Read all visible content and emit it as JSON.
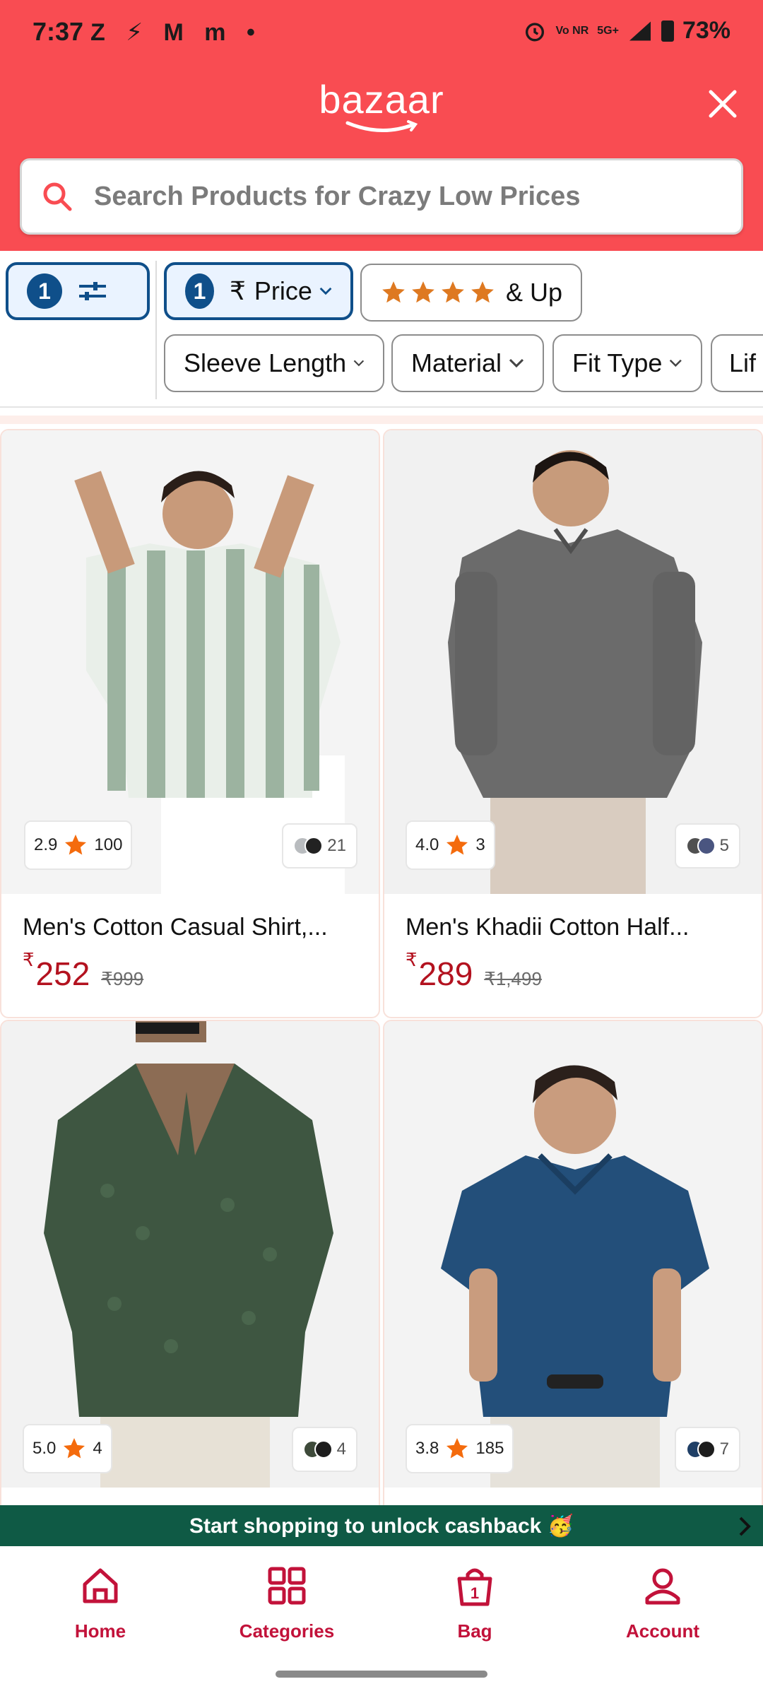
{
  "status_bar": {
    "time": "7:37",
    "notification_icons": "Z ⚡ M m •",
    "network_label": "Vo NR",
    "signal_label": "5G+",
    "battery": "73%"
  },
  "header": {
    "brand": "bazaar",
    "search_placeholder": "Search Products for Crazy Low Prices",
    "accent_color": "#f94c52"
  },
  "filters": {
    "all_filters_count": "1",
    "price_count": "1",
    "price_symbol": "₹",
    "price_label": "Price",
    "rating_label": "& Up",
    "chips": [
      "Sleeve Length",
      "Material",
      "Fit Type",
      "Lif"
    ]
  },
  "products": [
    {
      "rating": "2.9",
      "reviews": "100",
      "colors_count": "21",
      "title": "Men's Cotton Casual Shirt,...",
      "currency": "₹",
      "price": "252",
      "mrp": "₹999"
    },
    {
      "rating": "4.0",
      "reviews": "3",
      "colors_count": "5",
      "title": "Men's Khadii Cotton Half...",
      "currency": "₹",
      "price": "289",
      "mrp": "₹1,499"
    },
    {
      "rating": "5.0",
      "reviews": "4",
      "colors_count": "4"
    },
    {
      "rating": "3.8",
      "reviews": "185",
      "colors_count": "7"
    }
  ],
  "cashback_banner": "Start shopping to unlock cashback 🥳",
  "bottom_nav": {
    "home": "Home",
    "categories": "Categories",
    "bag": "Bag",
    "bag_count": "1",
    "account": "Account"
  }
}
